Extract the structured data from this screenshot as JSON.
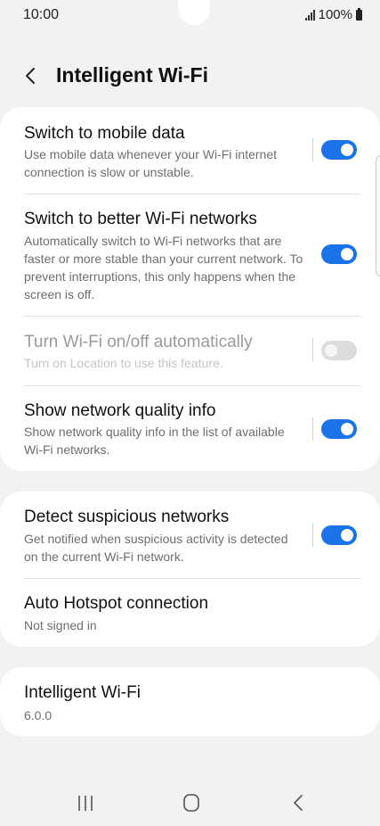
{
  "status": {
    "time": "10:00",
    "battery": "100%"
  },
  "header": {
    "back_icon": "chevron-left-icon",
    "title": "Intelligent Wi-Fi"
  },
  "sections": [
    {
      "rows": [
        {
          "title": "Switch to mobile data",
          "desc": "Use mobile data whenever your Wi-Fi internet connection is slow or unstable.",
          "toggle": true
        },
        {
          "title": "Switch to better Wi-Fi networks",
          "desc": "Automatically switch to Wi-Fi networks that are faster or more stable than your current network. To prevent interruptions, this only happens when the screen is off.",
          "toggle": true
        },
        {
          "title": "Turn Wi-Fi on/off automatically",
          "desc": "Turn on Location to use this feature.",
          "toggle": false,
          "disabled": true
        },
        {
          "title": "Show network quality info",
          "desc": "Show network quality info in the list of available Wi-Fi networks.",
          "toggle": true
        }
      ]
    },
    {
      "rows": [
        {
          "title": "Detect suspicious networks",
          "desc": "Get notified when suspicious activity is detected on the current Wi-Fi network.",
          "toggle": true
        },
        {
          "title": "Auto Hotspot connection",
          "desc": "Not signed in"
        }
      ]
    },
    {
      "rows": [
        {
          "title": "Intelligent Wi-Fi",
          "desc": "6.0.0"
        }
      ]
    }
  ],
  "navbar": {
    "recents_icon": "recents-icon",
    "home_icon": "home-icon",
    "back_icon": "back-icon"
  },
  "colors": {
    "accent": "#1a73e8",
    "background": "#f2f2f4",
    "card": "#ffffff"
  }
}
